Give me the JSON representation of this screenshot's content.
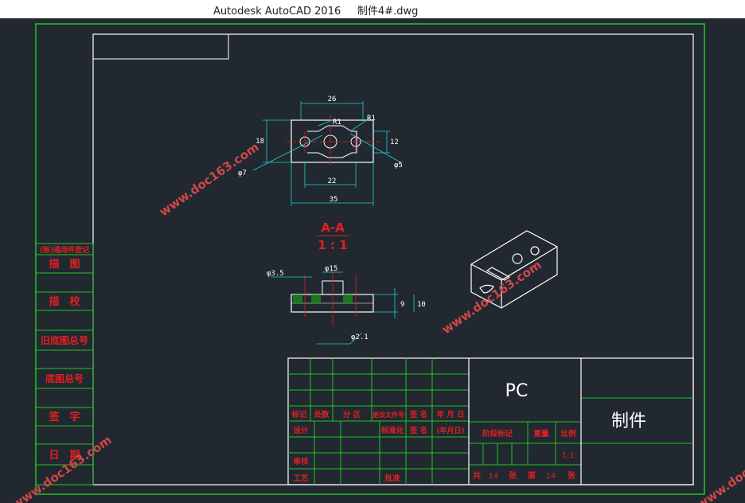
{
  "window": {
    "title": "Autodesk AutoCAD 2016     制件4#.dwg"
  },
  "colors": {
    "background": "#212830",
    "frame": "#22c522",
    "lines": "#ffffff",
    "dimension": "#22cccc",
    "centerline": "#e02020",
    "label": "#e02020",
    "watermark": "#d04848"
  },
  "watermark": "www.doc163.com",
  "left_strip": [
    "(账)通用件登记",
    "描　图",
    "描　校",
    "旧底图总号",
    "底图总号",
    "签　字",
    "日　期"
  ],
  "section": {
    "name": "A-A",
    "scale": "1 : 1"
  },
  "top_view_dims": {
    "width_top": "26",
    "width_bottom": "35",
    "inner": "22",
    "height_left": "18",
    "height_right": "12",
    "r1": "R1",
    "r2": "R1",
    "dia_left": "φ7",
    "dia_right": "φ5"
  },
  "section_view_dims": {
    "dia_hole": "φ3.5",
    "dia_boss": "φ15",
    "dia_bottom": "φ2.1",
    "h1": "9",
    "h2": "10"
  },
  "title_block": {
    "material": "PC",
    "part_name": "制件",
    "col_headers": [
      "标记",
      "处数",
      "分 区",
      "更改文件号",
      "签 名",
      "年 月 日"
    ],
    "row_design": [
      "设计",
      "标准化",
      "签 名",
      "(年月日)"
    ],
    "row_review": "审核",
    "row_process": [
      "工艺",
      "批准"
    ],
    "stage_header": [
      "阶段标记",
      "重量",
      "比例"
    ],
    "scale_value": "1:1",
    "sheets": [
      "共",
      "14",
      "张",
      "第",
      "14",
      "张"
    ]
  }
}
